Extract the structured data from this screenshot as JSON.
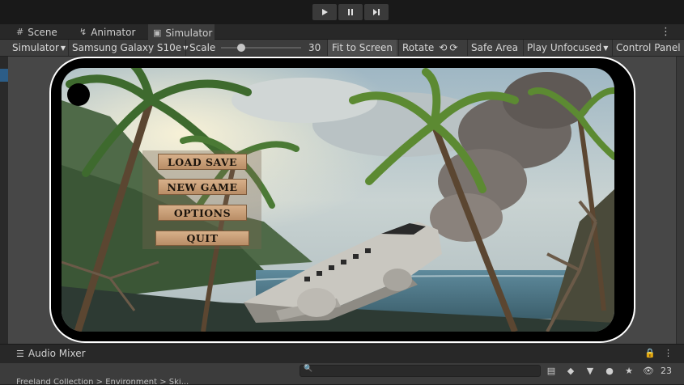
{
  "playbar": {
    "play_icon": "play-icon",
    "pause_icon": "pause-icon",
    "step_icon": "step-icon"
  },
  "tabs": [
    {
      "label": "Scene",
      "icon": "grid-icon"
    },
    {
      "label": "Animator",
      "icon": "animator-icon"
    },
    {
      "label": "Simulator",
      "icon": "simulator-icon"
    }
  ],
  "toolbar": {
    "mode_dropdown": "Simulator",
    "device_dropdown": "Samsung Galaxy S10e",
    "scale_label": "Scale",
    "scale_value": "30",
    "scale_fraction": 0.2,
    "fit_button": "Fit to Screen",
    "rotate_label": "Rotate",
    "safe_area_button": "Safe Area",
    "play_mode_dropdown": "Play Unfocused",
    "control_panel_button": "Control Panel"
  },
  "game_menu": {
    "buttons": [
      "LOAD SAVE",
      "NEW GAME",
      "OPTIONS",
      "QUIT"
    ]
  },
  "bottom": {
    "tab_label": "Audio Mixer",
    "search_placeholder": "",
    "hidden_count": "23",
    "breadcrumb": "Freeland Collection > Environment > Ski..."
  },
  "colors": {
    "button_face": "#c89e75",
    "button_text": "#1c140c",
    "device_outline": "#ffffff",
    "selection_accent": "#2c5d87"
  }
}
